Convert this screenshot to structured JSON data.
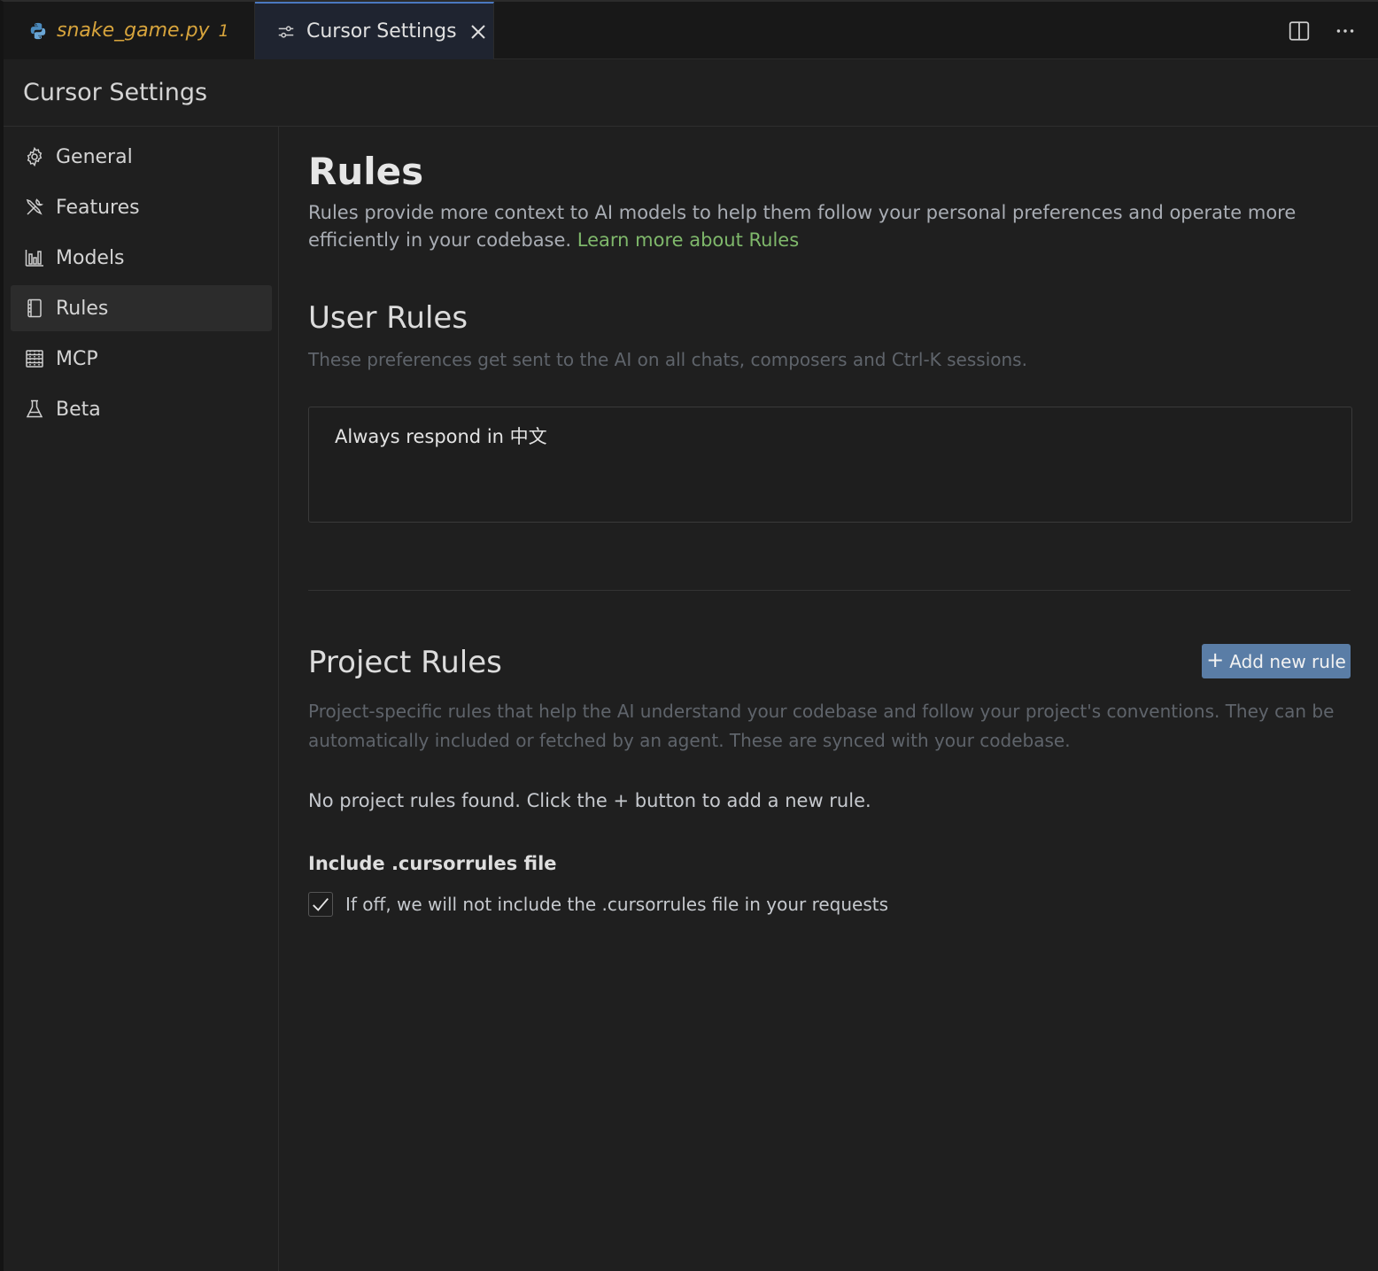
{
  "tabs": [
    {
      "label": "snake_game.py",
      "badge": "1",
      "icon": "python-icon",
      "active": false
    },
    {
      "label": "Cursor Settings",
      "icon": "settings-sliders-icon",
      "active": true
    }
  ],
  "tabbar_actions": [
    "split-editor-icon",
    "more-actions-icon"
  ],
  "page_header": {
    "title": "Cursor Settings"
  },
  "sidebar": {
    "items": [
      {
        "label": "General",
        "icon": "gear-icon"
      },
      {
        "label": "Features",
        "icon": "tools-icon"
      },
      {
        "label": "Models",
        "icon": "bar-chart-icon"
      },
      {
        "label": "Rules",
        "icon": "book-icon",
        "active": true
      },
      {
        "label": "MCP",
        "icon": "server-icon"
      },
      {
        "label": "Beta",
        "icon": "flask-icon"
      }
    ]
  },
  "main": {
    "title": "Rules",
    "description": "Rules provide more context to AI models to help them follow your personal preferences and operate more efficiently in your codebase.",
    "learn_more": "Learn more about Rules",
    "user_rules": {
      "title": "User Rules",
      "subtitle": "These preferences get sent to the AI on all chats, composers and Ctrl-K sessions.",
      "value": "Always respond in 中文"
    },
    "project_rules": {
      "title": "Project Rules",
      "add_button": "Add new rule",
      "subtitle": "Project-specific rules that help the AI understand your codebase and follow your project's conventions. They can be automatically included or fetched by an agent. These are synced with your codebase.",
      "empty_message": "No project rules found. Click the + button to add a new rule.",
      "cursorrules_label": "Include .cursorrules file",
      "cursorrules_checkbox_label": "If off, we will not include the .cursorrules file in your requests",
      "cursorrules_checked": true
    }
  },
  "colors": {
    "accent_button": "#5a7da6",
    "link": "#7fb86b",
    "tab_modified": "#d7a43c"
  }
}
